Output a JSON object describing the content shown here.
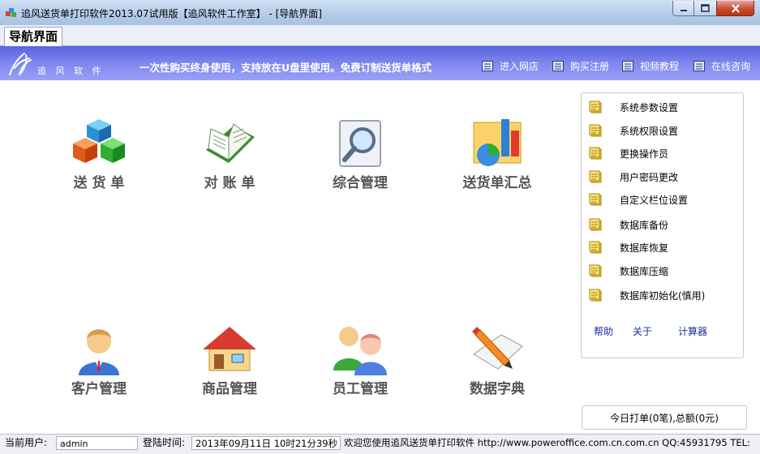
{
  "window": {
    "title": "追风送货单打印软件2013.07试用版【追风软件工作室】 - [导航界面]"
  },
  "tab": {
    "label": "导航界面"
  },
  "banner": {
    "logo_text": "追 风 软 件",
    "slogan": "一次性购买终身使用，支持放在U盘里使用。免费订制送货单格式",
    "links": [
      "进入网店",
      "购买注册",
      "视频教程",
      "在线咨询"
    ]
  },
  "modules": {
    "delivery": "送 货 单",
    "reconcile": "对 账 单",
    "general": "综合管理",
    "summary": "送货单汇总",
    "customer": "客户管理",
    "product": "商品管理",
    "staff": "员工管理",
    "dictionary": "数据字典"
  },
  "side_panel": {
    "items": [
      "系统参数设置",
      "系统权限设置",
      "更换操作员",
      "用户密码更改",
      "自定义栏位设置",
      "数据库备份",
      "数据库恢复",
      "数据库压缩",
      "数据库初始化(慎用)"
    ],
    "help": "帮助",
    "about": "关于",
    "calculator": "计算器"
  },
  "today": "今日打单(0笔),总额(0元)",
  "status": {
    "user_label": "当前用户:",
    "user": "admin",
    "login_label": "登陆时间:",
    "login_time": "2013年09月11日 10时21分39秒",
    "welcome": "欢迎您使用追风送货单打印软件 http://www.poweroffice.com.cn.com.cn QQ:45931795 TEL:"
  },
  "colors": {
    "banner": "#7f87ef",
    "link": "#1a2fa0",
    "close_button": "#c94b2f"
  }
}
